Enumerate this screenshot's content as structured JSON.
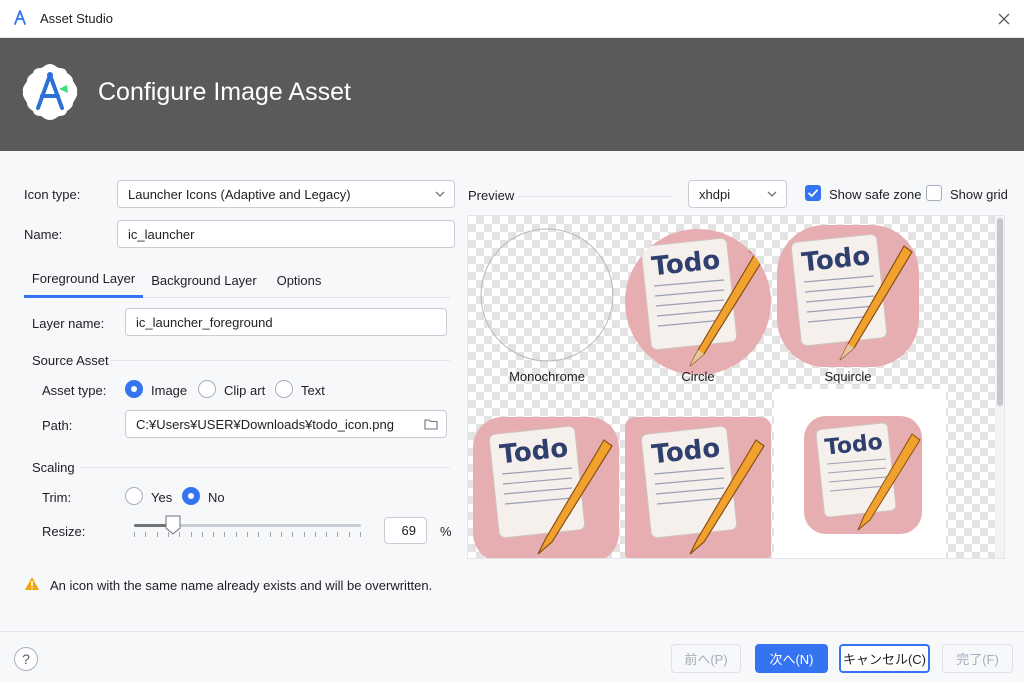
{
  "window": {
    "title": "Asset Studio",
    "close_icon": "close-icon"
  },
  "banner": {
    "heading": "Configure Image Asset",
    "logo": "android-studio-logo"
  },
  "form": {
    "icon_type_label": "Icon type:",
    "icon_type_value": "Launcher Icons (Adaptive and Legacy)",
    "name_label": "Name:",
    "name_value": "ic_launcher"
  },
  "tabs": [
    {
      "label": "Foreground Layer",
      "active": true
    },
    {
      "label": "Background Layer",
      "active": false
    },
    {
      "label": "Options",
      "active": false
    }
  ],
  "foreground": {
    "layer_name_label": "Layer name:",
    "layer_name_value": "ic_launcher_foreground",
    "source_asset_title": "Source Asset",
    "asset_type_label": "Asset type:",
    "asset_type_options": [
      "Image",
      "Clip art",
      "Text"
    ],
    "asset_type_selected": "Image",
    "path_label": "Path:",
    "path_value": "C:¥Users¥USER¥Downloads¥todo_icon.png",
    "scaling_title": "Scaling",
    "trim_label": "Trim:",
    "trim_options": [
      "Yes",
      "No"
    ],
    "trim_selected": "No",
    "resize_label": "Resize:",
    "resize_value": "69",
    "resize_unit": "%",
    "resize_fraction": 0.17
  },
  "warning": {
    "text": "An icon with the same name already exists and will be overwritten."
  },
  "preview": {
    "title": "Preview",
    "density_value": "xhdpi",
    "show_safe_zone_label": "Show safe zone",
    "show_safe_zone_checked": true,
    "show_grid_label": "Show grid",
    "show_grid_checked": false,
    "captions": [
      "Monochrome",
      "Circle",
      "Squircle"
    ],
    "todo_text": "Todo"
  },
  "footer": {
    "help": "?",
    "prev": "前へ(P)",
    "next": "次へ(N)",
    "cancel": "キャンセル(C)",
    "finish": "完了(F)"
  },
  "colors": {
    "accent": "#3574f0",
    "banner": "#5a5a5a",
    "warning": "#f2a60d"
  }
}
